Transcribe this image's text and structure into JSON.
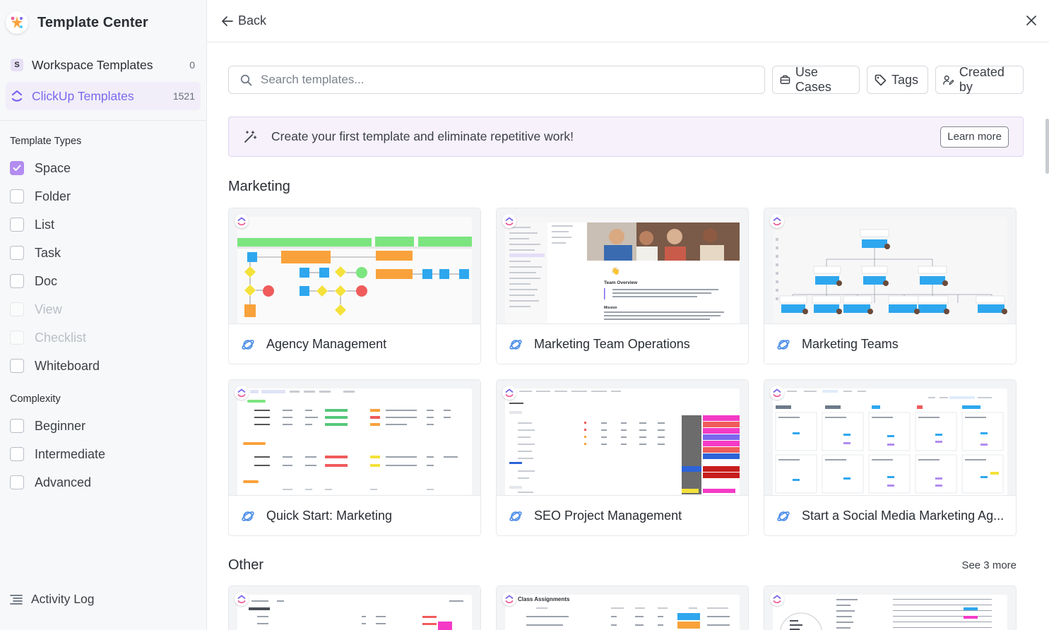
{
  "app": {
    "title": "Template Center"
  },
  "sidebar": {
    "nav": [
      {
        "label": "Workspace Templates",
        "count": "0",
        "badge": "S"
      },
      {
        "label": "ClickUp Templates",
        "count": "1521"
      }
    ],
    "template_types": {
      "title": "Template Types",
      "options": [
        {
          "label": "Space",
          "checked": true,
          "disabled": false
        },
        {
          "label": "Folder",
          "checked": false,
          "disabled": false
        },
        {
          "label": "List",
          "checked": false,
          "disabled": false
        },
        {
          "label": "Task",
          "checked": false,
          "disabled": false
        },
        {
          "label": "Doc",
          "checked": false,
          "disabled": false
        },
        {
          "label": "View",
          "checked": false,
          "disabled": true
        },
        {
          "label": "Checklist",
          "checked": false,
          "disabled": true
        },
        {
          "label": "Whiteboard",
          "checked": false,
          "disabled": false
        }
      ]
    },
    "complexity": {
      "title": "Complexity",
      "options": [
        {
          "label": "Beginner",
          "checked": false
        },
        {
          "label": "Intermediate",
          "checked": false
        },
        {
          "label": "Advanced",
          "checked": false
        }
      ]
    },
    "activity_log": "Activity Log"
  },
  "topbar": {
    "back_label": "Back"
  },
  "filters": {
    "search_placeholder": "Search templates...",
    "use_cases": "Use Cases",
    "tags": "Tags",
    "created_by": "Created by"
  },
  "banner": {
    "text": "Create your first template and eliminate repetitive work!",
    "button": "Learn more"
  },
  "sections": {
    "marketing": {
      "title": "Marketing",
      "cards": [
        {
          "name": "Agency Management",
          "preview": "whiteboard-flowchart"
        },
        {
          "name": "Marketing Team Operations",
          "preview": "doc-team-overview"
        },
        {
          "name": "Marketing Teams",
          "preview": "org-chart"
        },
        {
          "name": "Quick Start: Marketing",
          "preview": "list-table"
        },
        {
          "name": "SEO Project Management",
          "preview": "table-colored"
        },
        {
          "name": "Start a Social Media Marketing Ag...",
          "preview": "board-kanban"
        }
      ]
    },
    "other": {
      "title": "Other",
      "see_more": "See 3 more",
      "cards": [
        {
          "name": "",
          "preview": "list-table"
        },
        {
          "name": "",
          "preview": "class-assignments",
          "preview_title": "Class Assignments"
        },
        {
          "name": "",
          "preview": "table"
        }
      ]
    }
  },
  "colors": {
    "accent": "#7b68ee",
    "checkbox_checked": "#b28cf0",
    "banner_bg": "#f6f1fb",
    "space_icon": "#4f8fe8"
  }
}
